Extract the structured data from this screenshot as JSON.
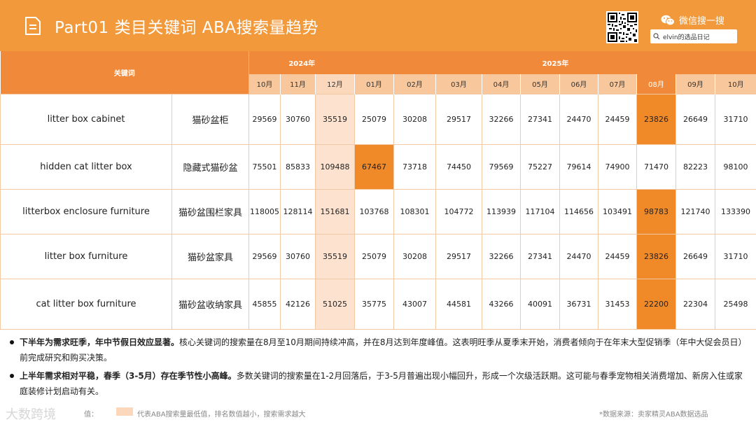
{
  "header": {
    "title": "Part01 类目关键词 ABA搜索量趋势",
    "wechat_label": "微信搜一搜",
    "search_text": "elvin的选品日记"
  },
  "table": {
    "keyword_header": "关键词",
    "years": [
      "2024年",
      "2025年"
    ],
    "months": [
      "10月",
      "11月",
      "12月",
      "01月",
      "02月",
      "03月",
      "04月",
      "05月",
      "06月",
      "07月",
      "08月",
      "09月",
      "10月"
    ],
    "rows": [
      {
        "en": "litter box cabinet",
        "cn": "猫砂盆柜",
        "values": [
          "29569",
          "30760",
          "35519",
          "25079",
          "30208",
          "29517",
          "32266",
          "27341",
          "24470",
          "24459",
          "23826",
          "26649",
          "31710"
        ]
      },
      {
        "en": "hidden cat litter box",
        "cn": "隐藏式猫砂盆",
        "values": [
          "75501",
          "85833",
          "109488",
          "67467",
          "73718",
          "74450",
          "79569",
          "75227",
          "79614",
          "74900",
          "71470",
          "82223",
          "98100"
        ]
      },
      {
        "en": "litterbox enclosure furniture",
        "cn": "猫砂盆围栏家具",
        "values": [
          "118005",
          "128114",
          "151681",
          "103768",
          "108301",
          "104772",
          "113939",
          "117104",
          "114656",
          "103491",
          "98783",
          "121740",
          "133390"
        ]
      },
      {
        "en": "litter box furniture",
        "cn": "猫砂盆家具",
        "values": [
          "29569",
          "30760",
          "35519",
          "25079",
          "30208",
          "29517",
          "32266",
          "27341",
          "24470",
          "24459",
          "23826",
          "26649",
          "31710"
        ]
      },
      {
        "en": "cat litter box furniture",
        "cn": "猫砂盆收纳家具",
        "values": [
          "45855",
          "42126",
          "51025",
          "35775",
          "43007",
          "44581",
          "43266",
          "40091",
          "36731",
          "31453",
          "22200",
          "22304",
          "25498"
        ]
      }
    ],
    "highlight_high_col": 2,
    "highlight_low": [
      [
        0,
        10
      ],
      [
        1,
        3
      ],
      [
        2,
        10
      ],
      [
        3,
        10
      ],
      [
        4,
        10
      ]
    ],
    "colors": {
      "header": "#f29a3b",
      "low": "#f08a28",
      "high": "#fde3cf"
    }
  },
  "notes": [
    {
      "bold": "下半年为需求旺季，年中节假日效应显著。",
      "text": "核心关键词的搜索量在8月至10月期间持续冲高，并在8月达到年度峰值。这表明旺季从夏季末开始，消费者倾向于在年末大型促销季（年中大促会员日）前完成研究和购买决策。"
    },
    {
      "bold": "上半年需求相对平稳，春季（3-5月）存在季节性小高峰。",
      "text": "多数关键词的搜索量在1-2月回落后，于3-5月普遍出现小幅回升，形成一个次级活跃期。这可能与春季宠物相关消费增加、新房入住或家庭装修计划启动有关。"
    }
  ],
  "footer": {
    "watermark": "大数跨境",
    "legend_low_text": "值：",
    "legend_high_text": "代表ABA搜索量最低值，排名数值越小，搜索需求越大",
    "source": "*数据来源：卖家精灵ABA数据选品"
  }
}
